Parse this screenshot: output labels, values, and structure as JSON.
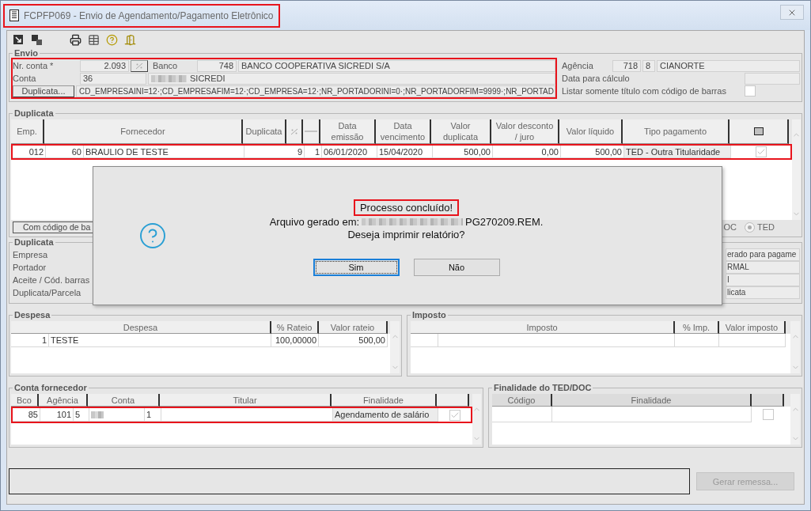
{
  "window": {
    "title": "FCPFP069 - Envio de Agendamento/Pagamento Eletrônico",
    "highlighted": true
  },
  "envio": {
    "title": "Envio",
    "highlighted": true,
    "nr_conta_label": "Nr. conta *",
    "nr_conta": "2.093",
    "banco_label": "Banco",
    "banco_codigo": "748",
    "banco_nome": "BANCO COOPERATIVA SICREDI S/A",
    "conta_label": "Conta",
    "conta": "36",
    "conta_nome": "SICREDI",
    "duplicata_button": "Duplicata...",
    "filtro": "CD_EMPRESAINI=12·;CD_EMPRESAFIM=12·;CD_EMPRESA=12·;NR_PORTADORINI=0·;NR_PORTADORFIM=9999·;NR_PORTAD",
    "agencia_label": "Agência",
    "agencia": "718",
    "agencia_digito": "8",
    "agencia_nome": "CIANORTE",
    "data_calculo_label": "Data para cálculo",
    "listar_label": "Listar somente título com código de barras",
    "listar_checked": false
  },
  "duplicata": {
    "title": "Duplicata",
    "headers": [
      {
        "kind": "text",
        "label": "Emp."
      },
      {
        "kind": "text",
        "label": "Fornecedor"
      },
      {
        "kind": "text",
        "label": "Duplicata"
      },
      {
        "kind": "percent"
      },
      {
        "kind": "dash"
      },
      {
        "kind": "text",
        "label": "Data emissão"
      },
      {
        "kind": "text",
        "label": "Data vencimento"
      },
      {
        "kind": "text",
        "label": "Valor duplicata"
      },
      {
        "kind": "text",
        "label": "Valor desconto / juro"
      },
      {
        "kind": "text",
        "label": "Valor líquido"
      },
      {
        "kind": "text",
        "label": "Tipo pagamento"
      },
      {
        "kind": "square"
      }
    ],
    "rows": [
      {
        "cells": [
          "012",
          "60",
          "BRAULIO DE TESTE",
          "9",
          "1",
          "06/01/2020",
          "15/04/2020",
          "500,00",
          "0,00",
          "500,00",
          "TED - Outra Titularidade"
        ],
        "checked": true,
        "highlighted": true
      }
    ],
    "com_codigo_button": "Com código de ba",
    "radios": [
      {
        "kind": "text",
        "label": "OC"
      },
      {
        "kind": "radio",
        "label": "TED",
        "selected": true
      }
    ]
  },
  "duplicata_detail": {
    "title": "Duplicata",
    "labels": [
      "Empresa",
      "Portador",
      "Aceite / Cód. barras",
      "Duplicata/Parcela"
    ],
    "values": [
      "erado para pagame",
      "RMAL",
      "I",
      "licata"
    ]
  },
  "dialog": {
    "heading": "Processo concluído!",
    "heading_highlighted": true,
    "path_prefix": "Arquivo gerado em:",
    "path_suffix": "PG270209.REM.",
    "question": "Deseja imprimir relatório?",
    "buttons": [
      {
        "label": "Sim",
        "focused": true
      },
      {
        "label": "Não",
        "focused": false
      }
    ]
  },
  "despesa": {
    "title": "Despesa",
    "columns": [
      "Despesa",
      "% Rateio",
      "Valor rateio"
    ],
    "rows": [
      {
        "numero": "1",
        "despesa": "TESTE",
        "rateio": "100,00000",
        "valor": "500,00"
      }
    ]
  },
  "imposto": {
    "title": "Imposto",
    "columns": [
      "Imposto",
      "% Imp.",
      "Valor imposto"
    ]
  },
  "conta_fornecedor": {
    "title": "Conta fornecedor",
    "columns": [
      "Bco",
      "Agência",
      "Conta",
      "Titular",
      "Finalidade"
    ],
    "rows": [
      {
        "bco": "85",
        "agencia": "101",
        "agencia_digito": "5",
        "conta_digito": "1",
        "finalidade": "Agendamento de salário",
        "checked": true,
        "highlighted": true
      }
    ]
  },
  "finalidade_ted": {
    "title": "Finalidade do TED/DOC",
    "columns": [
      "Código",
      "Finalidade"
    ],
    "row_checked": false
  },
  "footer": {
    "button": "Gerar remessa...",
    "button_disabled": true
  }
}
